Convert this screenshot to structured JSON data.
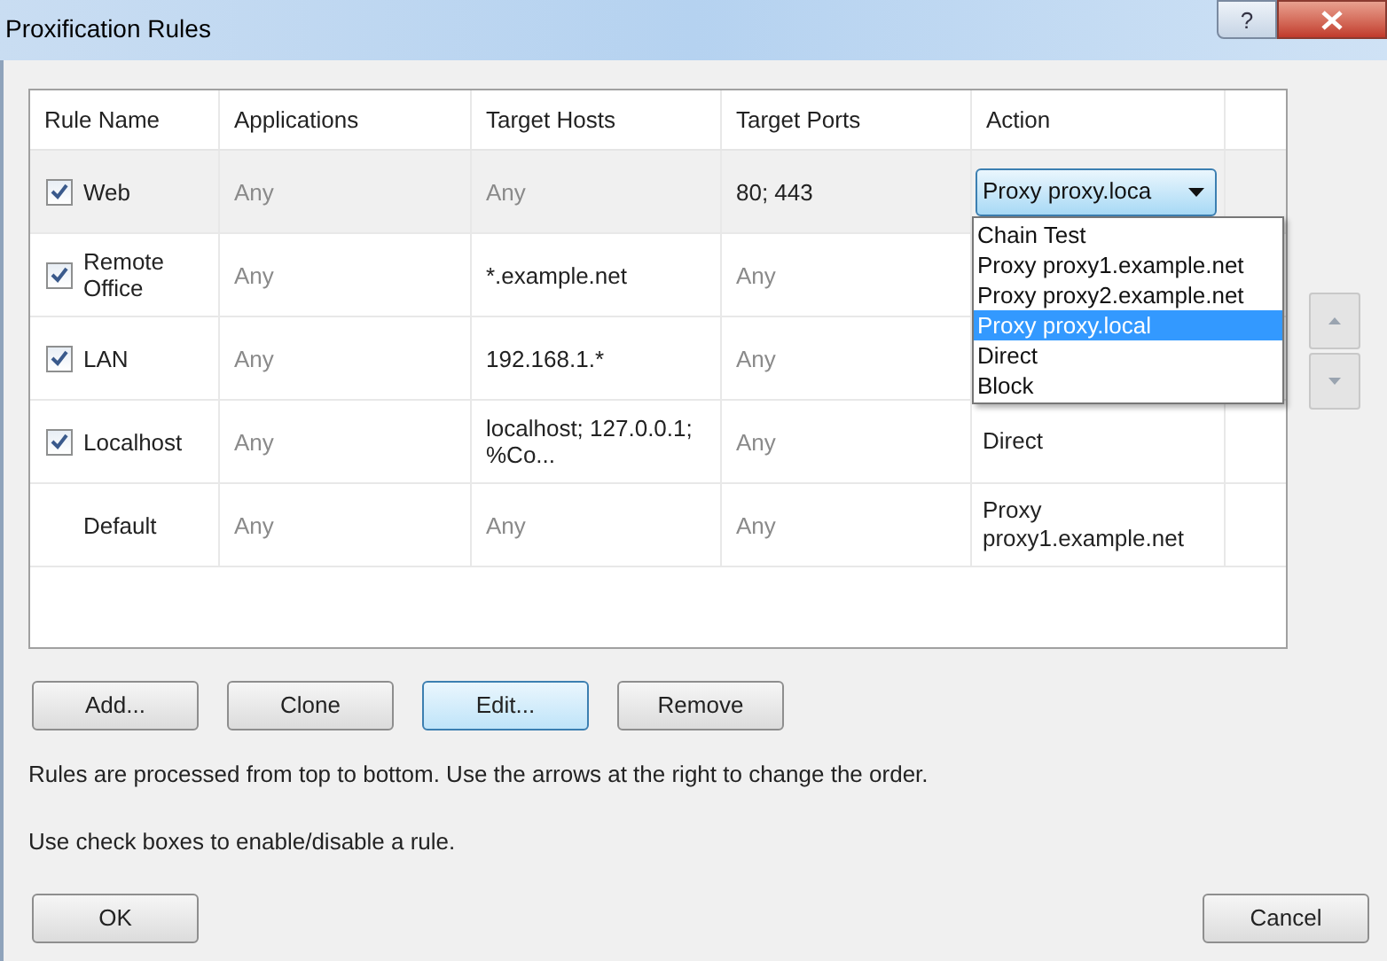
{
  "window": {
    "title": "Proxification Rules",
    "help_label": "?"
  },
  "table": {
    "columns": [
      "Rule Name",
      "Applications",
      "Target Hosts",
      "Target Ports",
      "Action"
    ],
    "rows": [
      {
        "kind": "rule",
        "checked": true,
        "selected": true,
        "name": "Web",
        "applications": {
          "text": "Any",
          "muted": true
        },
        "hosts": {
          "text": "Any",
          "muted": true
        },
        "ports": {
          "text": "80; 443",
          "muted": false
        },
        "action": {
          "kind": "combo",
          "text": "Proxy proxy.loca"
        }
      },
      {
        "kind": "rule",
        "checked": true,
        "selected": false,
        "name": "Remote Office",
        "applications": {
          "text": "Any",
          "muted": true
        },
        "hosts": {
          "text": "*.example.net",
          "muted": false
        },
        "ports": {
          "text": "Any",
          "muted": true
        },
        "action": {
          "kind": "empty"
        }
      },
      {
        "kind": "rule",
        "checked": true,
        "selected": false,
        "name": "LAN",
        "applications": {
          "text": "Any",
          "muted": true
        },
        "hosts": {
          "text": "192.168.1.*",
          "muted": false
        },
        "ports": {
          "text": "Any",
          "muted": true
        },
        "action": {
          "kind": "empty"
        }
      },
      {
        "kind": "rule",
        "checked": true,
        "selected": false,
        "name": "Localhost",
        "applications": {
          "text": "Any",
          "muted": true
        },
        "hosts": {
          "text": "localhost; 127.0.0.1; %Co...",
          "muted": false
        },
        "ports": {
          "text": "Any",
          "muted": true
        },
        "action": {
          "kind": "text",
          "text": "Direct"
        }
      },
      {
        "kind": "default",
        "selected": false,
        "name": "Default",
        "applications": {
          "text": "Any",
          "muted": true
        },
        "hosts": {
          "text": "Any",
          "muted": true
        },
        "ports": {
          "text": "Any",
          "muted": true
        },
        "action": {
          "kind": "text",
          "text": "Proxy proxy1.example.net"
        }
      }
    ]
  },
  "action_dropdown": {
    "options": [
      {
        "label": "Chain Test",
        "selected": false
      },
      {
        "label": "Proxy proxy1.example.net",
        "selected": false
      },
      {
        "label": "Proxy proxy2.example.net",
        "selected": false
      },
      {
        "label": "Proxy proxy.local",
        "selected": true
      },
      {
        "label": "Direct",
        "selected": false
      },
      {
        "label": "Block",
        "selected": false
      }
    ]
  },
  "buttons": [
    {
      "label": "Add...",
      "focused": false
    },
    {
      "label": "Clone",
      "focused": false
    },
    {
      "label": "Edit...",
      "focused": true
    },
    {
      "label": "Remove",
      "focused": false
    }
  ],
  "notes": [
    "Rules are processed from top to bottom. Use the arrows at the right to change the order.",
    "Use check boxes to enable/disable a rule."
  ],
  "footer_buttons": {
    "ok": "OK",
    "cancel": "Cancel"
  }
}
